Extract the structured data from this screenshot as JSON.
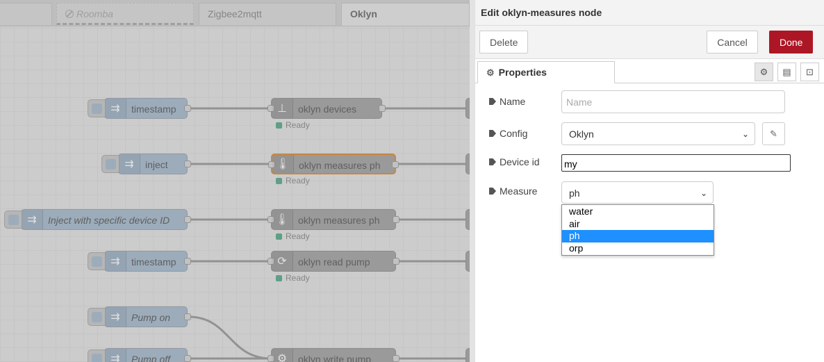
{
  "workspace_tabs": [
    {
      "label": "",
      "state": "normal"
    },
    {
      "label": "Roomba",
      "state": "disabled"
    },
    {
      "label": "Zigbee2mqtt",
      "state": "normal"
    },
    {
      "label": "Oklyn",
      "state": "active"
    }
  ],
  "nodes": {
    "n1": {
      "label": "timestamp"
    },
    "n2": {
      "label": "inject"
    },
    "n3": {
      "label": "Inject with specific device ID"
    },
    "n4": {
      "label": "timestamp"
    },
    "n5": {
      "label": "Pump on"
    },
    "n6": {
      "label": "Pump off"
    },
    "o1": {
      "label": "oklyn devices",
      "status": "Ready"
    },
    "o2": {
      "label": "oklyn measures ph",
      "status": "Ready"
    },
    "o3": {
      "label": "oklyn measures ph",
      "status": "Ready"
    },
    "o4": {
      "label": "oklyn read pump",
      "status": "Ready"
    },
    "o5": {
      "label": "oklyn write pump"
    }
  },
  "tray": {
    "title": "Edit oklyn-measures node",
    "delete_label": "Delete",
    "cancel_label": "Cancel",
    "done_label": "Done",
    "tab_label": "Properties"
  },
  "form": {
    "name_label": "Name",
    "name_placeholder": "Name",
    "config_label": "Config",
    "config_value": "Oklyn",
    "device_label": "Device id",
    "device_value": "my",
    "measure_label": "Measure",
    "measure_value": "ph",
    "measure_options": [
      "water",
      "air",
      "ph",
      "orp"
    ],
    "measure_selected": "ph"
  },
  "colors": {
    "done_button": "#ad1625",
    "selected_option": "#1e90ff",
    "selected_node_border": "#e08a2c"
  }
}
